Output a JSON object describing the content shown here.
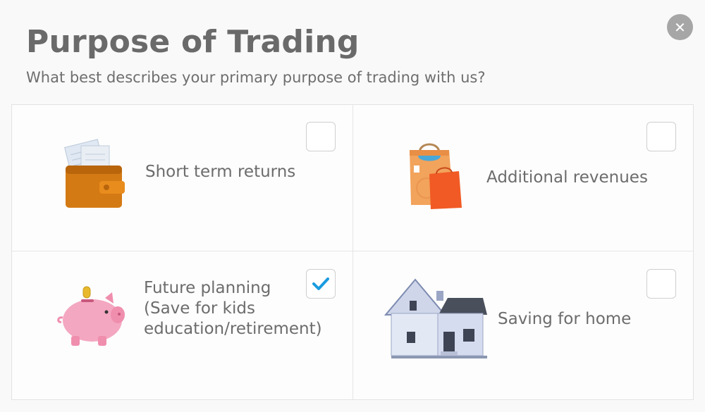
{
  "dialog": {
    "title": "Purpose of Trading",
    "subtitle": "What best describes your primary purpose of trading with us?",
    "close_symbol": "✕"
  },
  "options": [
    {
      "label": "Short term returns",
      "checked": false,
      "icon": "wallet-icon"
    },
    {
      "label": "Additional revenues",
      "checked": false,
      "icon": "shopping-bags-icon"
    },
    {
      "label": "Future planning\n(Save for kids\neducation/retirement)",
      "checked": true,
      "icon": "piggy-bank-icon"
    },
    {
      "label": "Saving for home",
      "checked": false,
      "icon": "house-icon"
    }
  ],
  "colors": {
    "check_accent": "#1a9be0"
  }
}
